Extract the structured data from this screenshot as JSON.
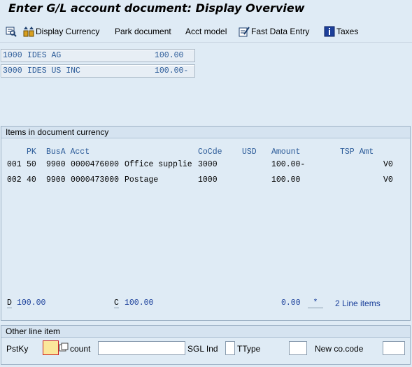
{
  "window": {
    "title": "Enter G/L account document: Display Overview"
  },
  "toolbar": {
    "display_currency": "Display Currency",
    "park_document": "Park document",
    "acct_model": "Acct model",
    "fast_data_entry": "Fast Data Entry",
    "taxes": "Taxes"
  },
  "company_codes": [
    {
      "code": "1000",
      "name": "IDES AG",
      "amount": "100.00"
    },
    {
      "code": "3000",
      "name": "IDES US INC",
      "amount": "100.00-"
    }
  ],
  "items": {
    "section_title": "Items in document currency",
    "headers": {
      "pk": "PK",
      "busa_acct": "BusA Acct",
      "cocde": "CoCde",
      "usd": "USD",
      "amount": "Amount",
      "tsp_amt": "TSP Amt"
    },
    "rows": [
      {
        "no": "001",
        "pk": "50",
        "busa": "9900",
        "acct": "0000476000",
        "text": "Office supplie",
        "cocde": "3000",
        "amount": "100.00-",
        "tx": "V0"
      },
      {
        "no": "002",
        "pk": "40",
        "busa": "9900",
        "acct": "0000473000",
        "text": "Postage",
        "cocde": "1000",
        "amount": "100.00",
        "tx": "V0"
      }
    ],
    "totals": {
      "d_label": "D",
      "d_value": "100.00",
      "c_label": "C",
      "c_value": "100.00",
      "balance": "0.00",
      "star": "*",
      "line_items": "2 Line items"
    }
  },
  "other_line_item": {
    "section_title": "Other line item",
    "pstky_label": "PstKy",
    "pstky_value": "",
    "account_label": "count",
    "sgl_ind_label": "SGL Ind",
    "ttype_label": "TType",
    "new_cocode_label": "New co.code"
  }
}
